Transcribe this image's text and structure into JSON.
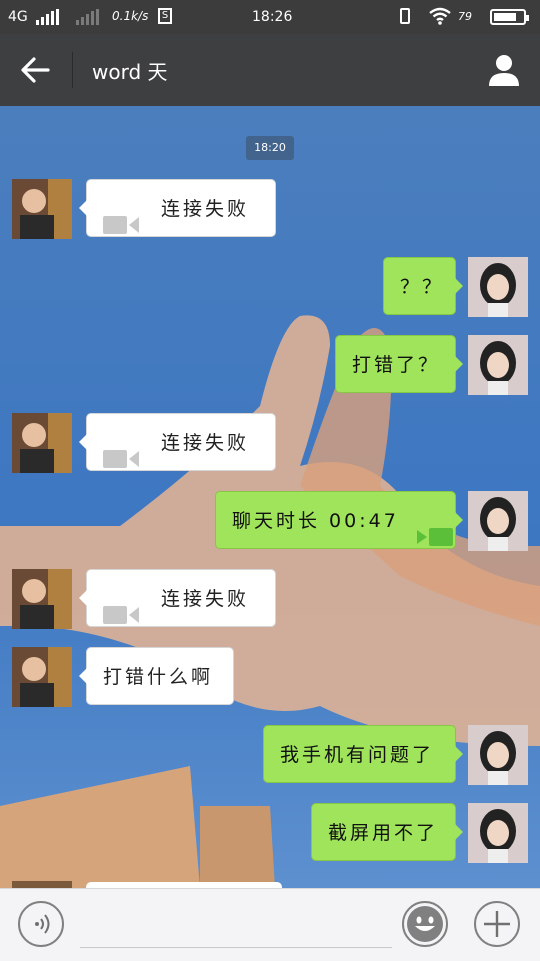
{
  "status_bar": {
    "network": "4G",
    "speed": "0.1k/s",
    "time": "18:26",
    "battery_percent": "79",
    "battery_level": 0.79
  },
  "header": {
    "title": "word 天",
    "back_icon": "arrow-left-icon",
    "profile_icon": "person-icon"
  },
  "chat": {
    "timestamp": "18:20",
    "messages": [
      {
        "side": "in",
        "text": "连接失败",
        "icon": "video-camera-icon"
      },
      {
        "side": "out",
        "text": "？？"
      },
      {
        "side": "out",
        "text": "打错了？"
      },
      {
        "side": "in",
        "text": "连接失败",
        "icon": "video-camera-icon"
      },
      {
        "side": "out",
        "text": "聊天时长 00:47",
        "icon": "video-camera-icon"
      },
      {
        "side": "in",
        "text": "连接失败",
        "icon": "video-camera-icon"
      },
      {
        "side": "in",
        "text": "打错什么啊"
      },
      {
        "side": "out",
        "text": "我手机有问题了"
      },
      {
        "side": "out",
        "text": "截屏用不了"
      }
    ]
  },
  "input_bar": {
    "voice_icon": "voice-icon",
    "emoji_icon": "smiley-icon",
    "add_icon": "plus-icon"
  },
  "colors": {
    "header_bg": "#3e3f41",
    "outgoing_bubble": "#9fe45a",
    "incoming_bubble": "#ffffff"
  }
}
